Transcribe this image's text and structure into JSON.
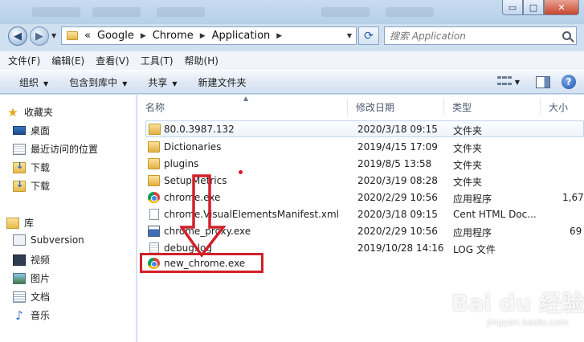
{
  "window": {
    "minimize_glyph": "▭",
    "maximize_glyph": "□",
    "close_glyph": "✕"
  },
  "nav": {
    "back_glyph": "◀",
    "forward_glyph": "▶",
    "address": {
      "prefix": "«",
      "crumbs": [
        "Google",
        "Chrome",
        "Application"
      ]
    },
    "search_placeholder": "搜索 Application"
  },
  "menubar": [
    "文件(F)",
    "编辑(E)",
    "查看(V)",
    "工具(T)",
    "帮助(H)"
  ],
  "toolbar": {
    "organize": "组织",
    "include_in_library": "包含到库中",
    "share": "共享",
    "new_folder": "新建文件夹",
    "help": "?"
  },
  "sidebar": {
    "favorites": {
      "label": "收藏夹",
      "items": [
        "桌面",
        "最近访问的位置",
        "下载",
        "下载"
      ]
    },
    "libraries": {
      "label": "库",
      "items": [
        "Subversion",
        "视频",
        "图片",
        "文档",
        "音乐"
      ]
    }
  },
  "columns": {
    "name": "名称",
    "date": "修改日期",
    "type": "类型",
    "size": "大小"
  },
  "files": [
    {
      "name": "80.0.3987.132",
      "date": "2020/3/18 09:15",
      "type": "文件夹",
      "size": "",
      "icon": "folder-icon"
    },
    {
      "name": "Dictionaries",
      "date": "2019/4/15 17:09",
      "type": "文件夹",
      "size": "",
      "icon": "folder-icon"
    },
    {
      "name": "plugins",
      "date": "2019/8/5 13:58",
      "type": "文件夹",
      "size": "",
      "icon": "folder-icon"
    },
    {
      "name": "SetupMetrics",
      "date": "2020/3/19 08:28",
      "type": "文件夹",
      "size": "",
      "icon": "folder-icon"
    },
    {
      "name": "chrome.exe",
      "date": "2020/2/29 10:56",
      "type": "应用程序",
      "size": "1,67",
      "icon": "chrome-icon"
    },
    {
      "name": "chrome.VisualElementsManifest.xml",
      "date": "2020/3/18 09:15",
      "type": "Cent HTML Doc...",
      "size": "",
      "icon": "xml-file-icon"
    },
    {
      "name": "chrome_proxy.exe",
      "date": "2020/2/29 10:56",
      "type": "应用程序",
      "size": "69",
      "icon": "app-icon"
    },
    {
      "name": "debug.log",
      "date": "2019/10/28 14:16",
      "type": "LOG 文件",
      "size": "",
      "icon": "log-file-icon"
    },
    {
      "name": "new_chrome.exe",
      "date": "",
      "type": "",
      "size": "",
      "icon": "chrome-icon"
    }
  ],
  "watermark": {
    "brand": "Bai du 经验",
    "url": "jingyan.baidu.com"
  },
  "colors": {
    "annotation_red": "#d2202a",
    "chrome_blue": "#4285f4"
  }
}
